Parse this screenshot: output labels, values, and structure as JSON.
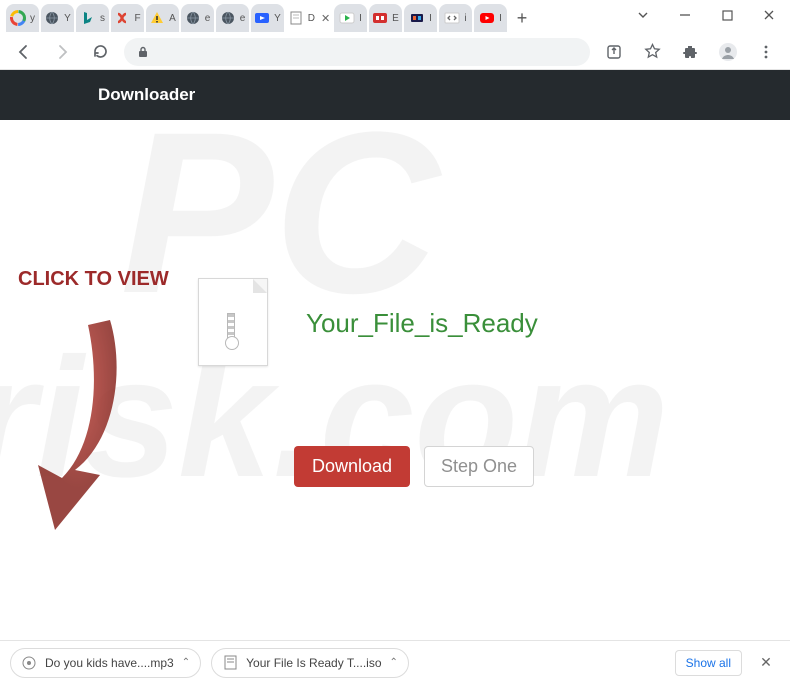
{
  "window": {
    "tabs": [
      {
        "label": "y",
        "favtype": "google"
      },
      {
        "label": "Y",
        "favtype": "globe-dark"
      },
      {
        "label": "s",
        "favtype": "bing"
      },
      {
        "label": "F",
        "favtype": "red-knot"
      },
      {
        "label": "A",
        "favtype": "warning"
      },
      {
        "label": "e",
        "favtype": "globe-dark"
      },
      {
        "label": "e",
        "favtype": "globe-dark"
      },
      {
        "label": "Y",
        "favtype": "video-blue"
      },
      {
        "label": "D",
        "favtype": "page",
        "active": true
      },
      {
        "label": "I",
        "favtype": "play-green"
      },
      {
        "label": "E",
        "favtype": "video-red"
      },
      {
        "label": "I",
        "favtype": "tv"
      },
      {
        "label": "i",
        "favtype": "code"
      },
      {
        "label": "I",
        "favtype": "youtube"
      }
    ],
    "newtab": "+"
  },
  "page": {
    "header": "Downloader",
    "click_to_view": "CLICK TO VIEW",
    "ready_text": "Your_File_is_Ready",
    "download_btn": "Download",
    "step_btn": "Step One"
  },
  "downloads": {
    "items": [
      {
        "name": "Do you kids have....mp3",
        "icon": "audio"
      },
      {
        "name": "Your File Is Ready T....iso",
        "icon": "disk"
      }
    ],
    "show_all": "Show all"
  },
  "watermark": {
    "top": "PC",
    "bottom": "risk.com"
  }
}
